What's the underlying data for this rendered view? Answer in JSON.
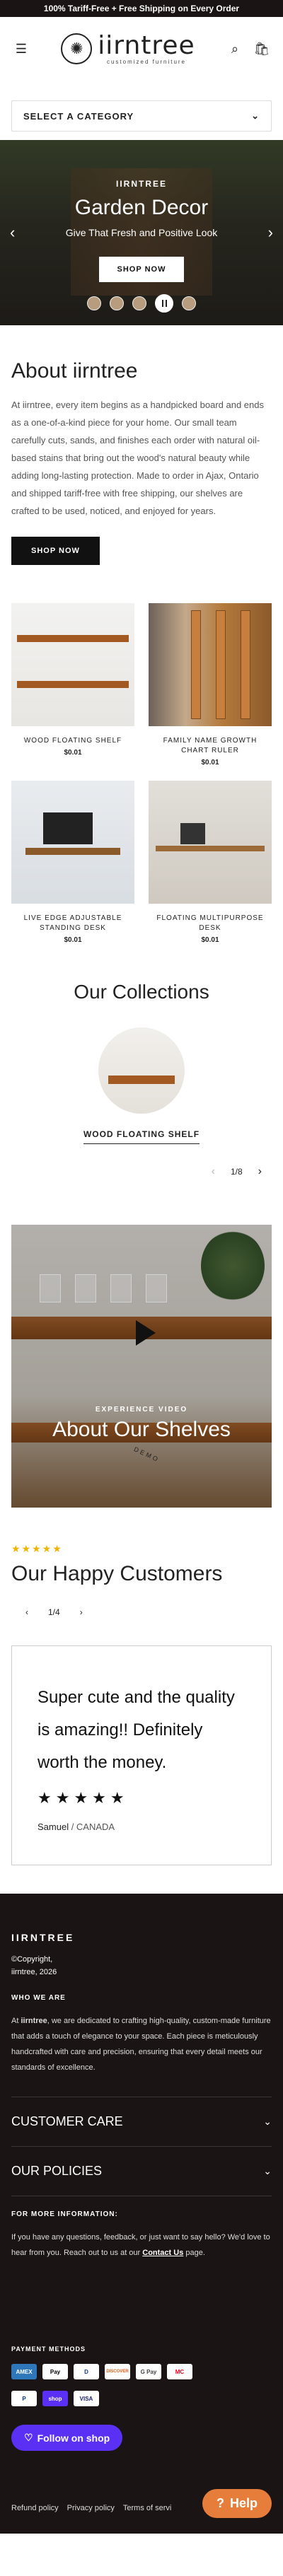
{
  "announcement": "100% Tariff-Free + Free Shipping on Every Order",
  "header": {
    "logo_name": "iirntree",
    "logo_tagline": "customized furniture",
    "icons": [
      "menu-icon",
      "search-icon",
      "cart-icon"
    ]
  },
  "category_select": {
    "label": "SELECT A CATEGORY"
  },
  "hero": {
    "brand": "IIRNTREE",
    "title": "Garden Decor",
    "subtitle": "Give That Fresh and Positive Look",
    "button": "SHOP NOW",
    "thumbs": 5,
    "active_index": 3
  },
  "about": {
    "title": "About iirntree",
    "body": "At iirntree, every item begins as a handpicked board and ends as a one-of-a-kind piece for your home. Our small team carefully cuts, sands, and finishes each order with natural oil-based stains that bring out the wood's natural beauty while adding long-lasting protection. Made to order in Ajax, Ontario and shipped tariff-free with free shipping, our shelves are crafted to be used, noticed, and enjoyed for years.",
    "button": "SHOP NOW"
  },
  "products": [
    {
      "name": "WOOD FLOATING SHELF",
      "price": "$0.01"
    },
    {
      "name": "FAMILY NAME GROWTH CHART RULER",
      "price": "$0.01"
    },
    {
      "name": "LIVE EDGE ADJUSTABLE STANDING DESK",
      "price": "$0.01"
    },
    {
      "name": "FLOATING MULTIPURPOSE DESK",
      "price": "$0.01"
    }
  ],
  "collections": {
    "title": "Our Collections",
    "item": "WOOD FLOATING SHELF",
    "pager": "1/8"
  },
  "video": {
    "subtitle": "EXPERIENCE VIDEO",
    "title": "About Our Shelves",
    "ring": "DEMO"
  },
  "testimonials": {
    "stars": "★★★★★",
    "title": "Our Happy Customers",
    "pager": "1/4",
    "quote": "Super cute and the quality is amazing!! Definitely worth the money.",
    "rating_stars": "★★★★★",
    "author": "Samuel",
    "location": " / CANADA"
  },
  "footer": {
    "brand": "IIRNTREE",
    "copyright_line1": "©Copyright,",
    "copyright_line2": "iirntree, 2026",
    "who_head": "WHO WE ARE",
    "who_text_pre": "At ",
    "who_text_brand": "iirntree",
    "who_text_post": ", we are dedicated to crafting high-quality, custom-made furniture that adds a touch of elegance to your space. Each piece is meticulously handcrafted with care and precision, ensuring that every detail meets our standards of excellence.",
    "accordion": [
      "CUSTOMER CARE",
      "OUR POLICIES"
    ],
    "more_head": "FOR MORE INFORMATION:",
    "more_text_pre": "If you have any questions, feedback, or just want to say hello? We'd love to hear from you. Reach out to us at our ",
    "more_link": "Contact Us",
    "more_text_post": " page.",
    "pay_head": "PAYMENT METHODS",
    "payments_row1": [
      "AMEX",
      "Pay",
      "D",
      "DISCOVER",
      "G Pay",
      "MC"
    ],
    "payments_row2": [
      "P",
      "shop",
      "VISA"
    ],
    "follow": "Follow on shop",
    "bottom_links": [
      "Refund policy",
      "Privacy policy",
      "Terms of servi"
    ],
    "help": "Help"
  }
}
